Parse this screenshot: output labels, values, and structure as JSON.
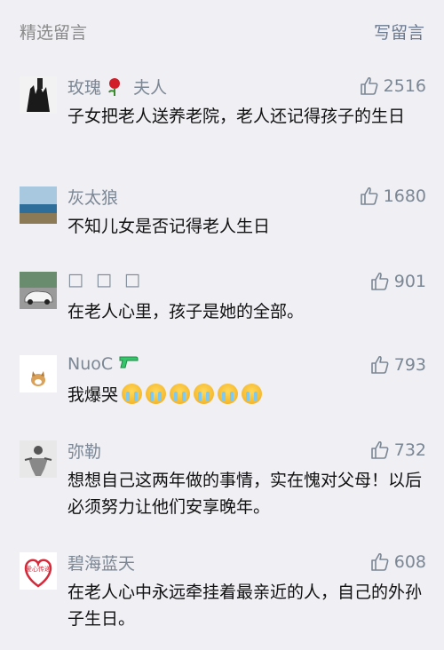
{
  "header": {
    "title": "精选留言",
    "write_label": "写留言"
  },
  "comments": [
    {
      "name": "玫瑰",
      "name_suffix": "夫人",
      "name_emoji": "rose-icon",
      "likes": "2516",
      "text": "子女把老人送养老院，老人还记得孩子的生日"
    },
    {
      "name": "灰太狼",
      "likes": "1680",
      "text": "不知儿女是否记得老人生日"
    },
    {
      "name": "□ □ □",
      "likes": "901",
      "text": "在老人心里，孩子是她的全部。"
    },
    {
      "name": "NuoC",
      "name_emoji": "water-gun-icon",
      "likes": "793",
      "text": "我爆哭",
      "text_emoji_count": 6,
      "text_emoji": "crying-face-icon"
    },
    {
      "name": "弥勒",
      "likes": "732",
      "text": "想想自己这两年做的事情，实在愧对父母！以后必须努力让他们安享晚年。"
    },
    {
      "name": "碧海蓝天",
      "likes": "608",
      "text": "在老人心中永远牵挂着最亲近的人，自己的外孙子生日。",
      "avatar_text": "爱心传递"
    }
  ],
  "colors": {
    "background": "#efeff4",
    "meta_text": "#7b8794",
    "body_text": "#111111"
  }
}
